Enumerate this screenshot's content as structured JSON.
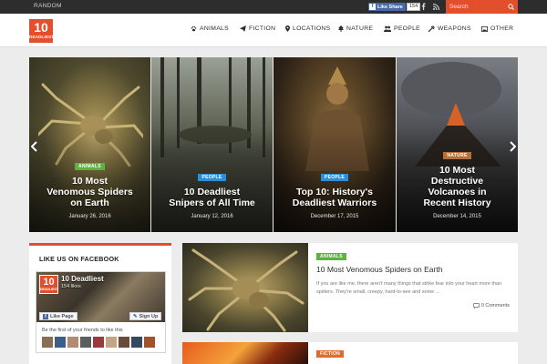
{
  "topbar": {
    "random_label": "RANDOM",
    "fb_like_label": "Like Share",
    "fb_like_count": "154",
    "search_placeholder": "Search"
  },
  "logo": {
    "number": "10",
    "word": "DEADLIEST"
  },
  "nav": [
    {
      "label": "ANIMALS",
      "icon": "paw-icon"
    },
    {
      "label": "FICTION",
      "icon": "paper-plane-icon"
    },
    {
      "label": "LOCATIONS",
      "icon": "map-marker-icon"
    },
    {
      "label": "NATURE",
      "icon": "tree-icon"
    },
    {
      "label": "PEOPLE",
      "icon": "users-icon"
    },
    {
      "label": "WEAPONS",
      "icon": "weapon-icon"
    },
    {
      "label": "OTHER",
      "icon": "image-icon"
    }
  ],
  "slides": [
    {
      "tag": "ANIMALS",
      "tag_color": "#5cb440",
      "title_lines": [
        "10 Most",
        "Venomous Spiders",
        "on Earth"
      ],
      "date": "January 26, 2016"
    },
    {
      "tag": "PEOPLE",
      "tag_color": "#2e8fd8",
      "title_lines": [
        "10 Deadliest",
        "Snipers of All Time"
      ],
      "date": "January 12, 2016"
    },
    {
      "tag": "PEOPLE",
      "tag_color": "#2e8fd8",
      "title_lines": [
        "Top 10: History's",
        "Deadliest Warriors"
      ],
      "date": "December 17, 2015"
    },
    {
      "tag": "NATURE",
      "tag_color": "#b5713c",
      "title_lines": [
        "10 Most",
        "Destructive",
        "Volcanoes in",
        "Recent History"
      ],
      "date": "December 14, 2015"
    }
  ],
  "facebook_widget": {
    "title": "LIKE US ON FACEBOOK",
    "page_name": "10 Deadliest",
    "page_likes": "154 likes",
    "like_page_label": "Like Page",
    "sign_up_label": "Sign Up",
    "friends_text": "Be the first of your friends to like this"
  },
  "articles": [
    {
      "tag": "ANIMALS",
      "title": "10 Most Venomous Spiders on Earth",
      "excerpt": "If you are like me, there aren't many things that strike fear into your heart more than spiders. They're small, creepy, hard-to-see and some ...",
      "comments": "0 Comments"
    },
    {
      "tag": "FICTION"
    }
  ],
  "colors": {
    "accent": "#e34e2c",
    "animals": "#5cb440",
    "people": "#2e8fd8",
    "fiction": "#e26a2c",
    "nature": "#b5713c"
  }
}
